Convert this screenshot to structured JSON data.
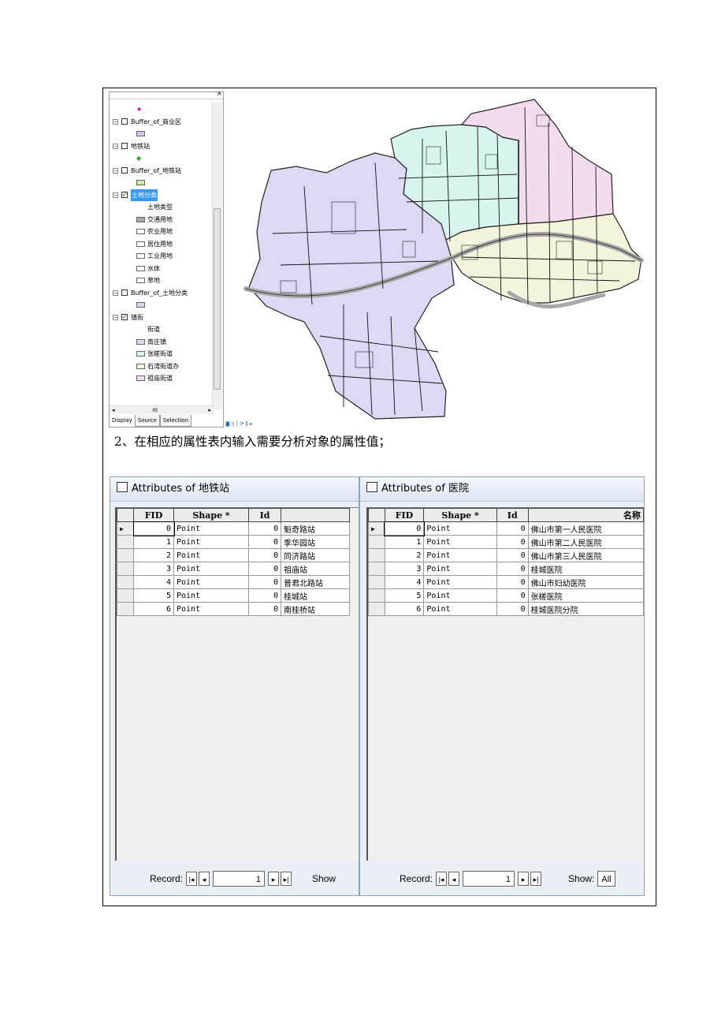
{
  "toc": {
    "tabs": [
      "Display",
      "Source",
      "Selection"
    ],
    "hscroll_mark": "III",
    "layers": [
      {
        "kind": "sym",
        "icon": "star-icon",
        "color": "#b000c0"
      },
      {
        "kind": "layer",
        "label": "Buffer_of_商业区",
        "checked": false
      },
      {
        "kind": "sym",
        "icon": "swatch",
        "color": "#d8c8e8"
      },
      {
        "kind": "layer",
        "label": "地铁站",
        "checked": false
      },
      {
        "kind": "sym",
        "icon": "diamond-icon",
        "color": "#22aa22"
      },
      {
        "kind": "layer",
        "label": "Buffer_of_地铁站",
        "checked": false
      },
      {
        "kind": "sym",
        "icon": "swatch",
        "color": "#d4e8b0"
      },
      {
        "kind": "layer",
        "label": "土地分类",
        "checked": true,
        "selected": true
      },
      {
        "kind": "hdr",
        "label": "土地类型"
      },
      {
        "kind": "cls",
        "label": "交通用地",
        "color": "#a8a8a8"
      },
      {
        "kind": "cls",
        "label": "农业用地",
        "color": "#ffffff"
      },
      {
        "kind": "cls",
        "label": "居住用地",
        "color": "#ffffff"
      },
      {
        "kind": "cls",
        "label": "工业用地",
        "color": "#ffffff"
      },
      {
        "kind": "cls",
        "label": "水体",
        "color": "#ffffff"
      },
      {
        "kind": "cls",
        "label": "草地",
        "color": "#ffffff"
      },
      {
        "kind": "layer",
        "label": "Buffer_of_土地分类",
        "checked": false
      },
      {
        "kind": "sym",
        "icon": "swatch",
        "color": "#d8d8f0"
      },
      {
        "kind": "layer",
        "label": "镇街",
        "checked": true
      },
      {
        "kind": "hdr",
        "label": "街道"
      },
      {
        "kind": "cls",
        "label": "南庄镇",
        "color": "#ddd8f4"
      },
      {
        "kind": "cls",
        "label": "张槎街道",
        "color": "#d8f4ee"
      },
      {
        "kind": "cls",
        "label": "石湾街道办",
        "color": "#f4f4dc"
      },
      {
        "kind": "cls",
        "label": "祖庙街道",
        "color": "#f4dcef"
      }
    ]
  },
  "map": {
    "regions": {
      "nanzhuang": "#ddd8f4",
      "zhangcha": "#d8f4ee",
      "shiwan": "#f4f4dc",
      "zumiao": "#f4dcef",
      "river": "#a8a8a8"
    }
  },
  "caption": "2、在相应的属性表内输入需要分析对象的属性值；",
  "left_table": {
    "title": "Attributes of 地铁站",
    "columns": [
      "FID",
      "Shape *",
      "Id",
      ""
    ],
    "rows": [
      [
        "0",
        "Point",
        "0",
        "魁奇路站"
      ],
      [
        "1",
        "Point",
        "0",
        "季华园站"
      ],
      [
        "2",
        "Point",
        "0",
        "同济路站"
      ],
      [
        "3",
        "Point",
        "0",
        "祖庙站"
      ],
      [
        "4",
        "Point",
        "0",
        "普君北路站"
      ],
      [
        "5",
        "Point",
        "0",
        "桂城站"
      ],
      [
        "6",
        "Point",
        "0",
        "南桂桥站"
      ]
    ],
    "record_label": "Record:",
    "record_value": "1",
    "show_label": "Show"
  },
  "right_table": {
    "title": "Attributes of 医院",
    "columns": [
      "FID",
      "Shape *",
      "Id",
      "名称"
    ],
    "rows": [
      [
        "0",
        "Point",
        "0",
        "佛山市第一人民医院"
      ],
      [
        "1",
        "Point",
        "0",
        "佛山市第二人民医院"
      ],
      [
        "2",
        "Point",
        "0",
        "佛山市第三人民医院"
      ],
      [
        "3",
        "Point",
        "0",
        "桂城医院"
      ],
      [
        "4",
        "Point",
        "0",
        "佛山市妇幼医院"
      ],
      [
        "5",
        "Point",
        "0",
        "张槎医院"
      ],
      [
        "6",
        "Point",
        "0",
        "桂城医院分院"
      ]
    ],
    "record_label": "Record:",
    "record_value": "1",
    "show_label": "Show:",
    "show_value": "All"
  }
}
